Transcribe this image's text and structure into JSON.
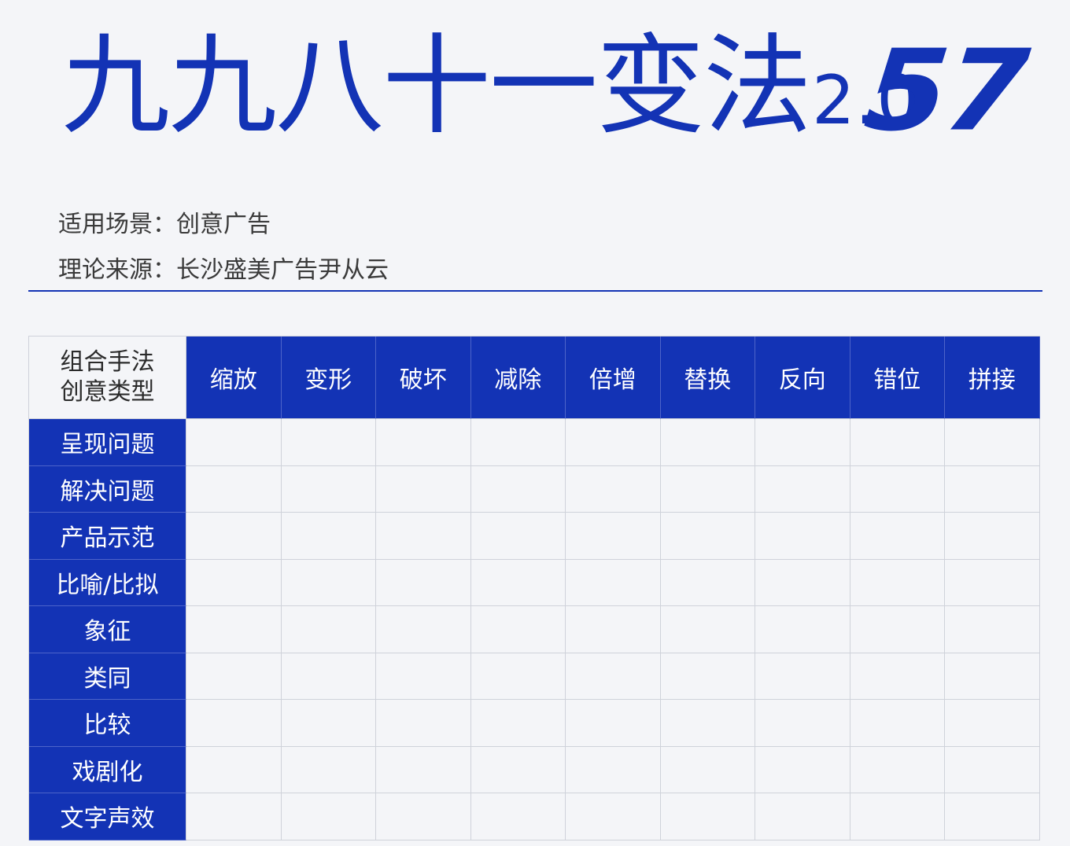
{
  "title": {
    "main": "九九八十一变法",
    "version": "2.0",
    "number": "57"
  },
  "meta": {
    "scene": "适用场景：创意广告",
    "source": "理论来源：长沙盛美广告尹从云"
  },
  "matrix": {
    "corner_line1": "组合手法",
    "corner_line2": "创意类型",
    "columns": [
      "缩放",
      "变形",
      "破坏",
      "减除",
      "倍增",
      "替换",
      "反向",
      "错位",
      "拼接"
    ],
    "rows": [
      "呈现问题",
      "解决问题",
      "产品示范",
      "比喻/比拟",
      "象征",
      "类同",
      "比较",
      "戏剧化",
      "文字声效"
    ]
  },
  "colors": {
    "brand_blue": "#1333b5",
    "background": "#f4f5f8"
  }
}
